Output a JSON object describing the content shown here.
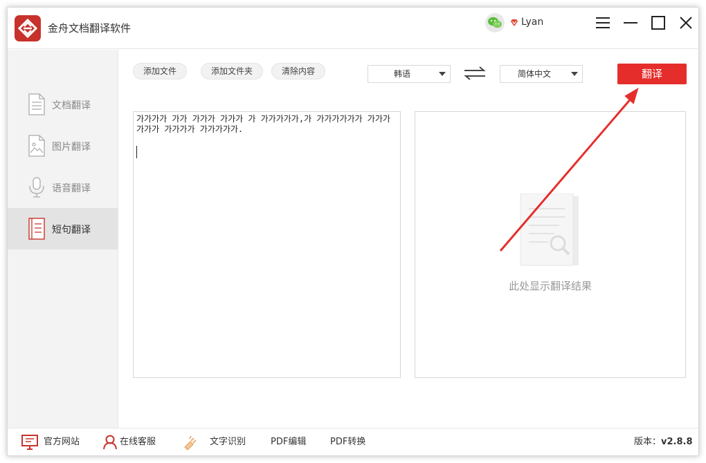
{
  "app": {
    "title": "金舟文档翻译软件",
    "username": "Lyan"
  },
  "sidebar": {
    "items": [
      {
        "label": "文档翻译",
        "icon": "document-icon"
      },
      {
        "label": "图片翻译",
        "icon": "image-icon"
      },
      {
        "label": "语音翻译",
        "icon": "microphone-icon"
      },
      {
        "label": "短句翻译",
        "icon": "sentence-icon",
        "active": true
      }
    ]
  },
  "toolbar": {
    "add_file": "添加文件",
    "add_folder": "添加文件夹",
    "clear": "清除内容",
    "source_lang": "韩语",
    "target_lang": "简体中文",
    "translate": "翻译"
  },
  "editor": {
    "source_text": "가가가가 가가 가가가 가가가 가 가가가가가,가 가가가가가가 가가가 가가가 가가가가 가가가가가."
  },
  "result": {
    "placeholder": "此处显示翻译结果"
  },
  "footer": {
    "website": "官方网站",
    "support": "在线客服",
    "ocr": "文字识别",
    "pdf_edit": "PDF编辑",
    "pdf_convert": "PDF转换",
    "version_label": "版本：",
    "version": "v2.8.8"
  },
  "colors": {
    "accent": "#e52e2b",
    "logo": "#c7322c"
  }
}
